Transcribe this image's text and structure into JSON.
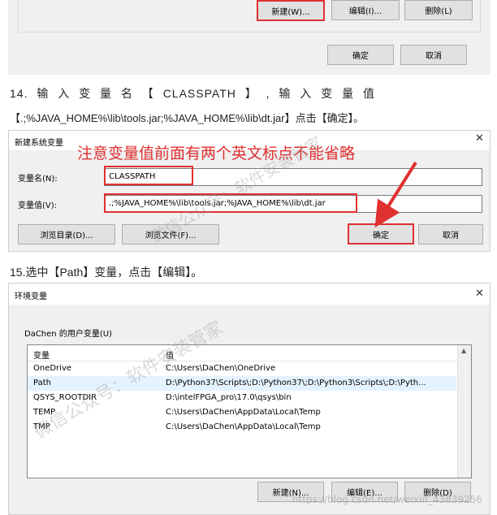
{
  "top_dialog": {
    "buttons": {
      "new": "新建(W)...",
      "edit": "编辑(I)...",
      "delete": "删除(L)"
    },
    "ok": "确定",
    "cancel": "取消"
  },
  "step14": {
    "line1": "14. 输 入 变 量 名 【 CLASSPATH 】 , 输 入 变 量 值",
    "line2": "【.;%JAVA_HOME%\\lib\\tools.jar;%JAVA_HOME%\\lib\\dt.jar】点击【确定】。"
  },
  "new_var_dialog": {
    "title": "新建系统变量",
    "annotation": "注意变量值前面有两个英文标点不能省略",
    "name_label": "变量名(N):",
    "name_value": "CLASSPATH",
    "value_label": "变量值(V):",
    "value_value": ".;%JAVA_HOME%\\lib\\tools.jar;%JAVA_HOME%\\lib\\dt.jar",
    "browse_dir": "浏览目录(D)...",
    "browse_file": "浏览文件(F)...",
    "ok": "确定",
    "cancel": "取消"
  },
  "step15": {
    "text": "15.选中【Path】变量，点击【编辑】。"
  },
  "env_dialog": {
    "title": "环境变量",
    "user_group": "DaChen 的用户变量(U)",
    "col_var": "变量",
    "col_val": "值",
    "rows": [
      {
        "name": "OneDrive",
        "value": "C:\\Users\\DaChen\\OneDrive"
      },
      {
        "name": "Path",
        "value": "D:\\Python37\\Scripts\\;D:\\Python37\\;D:\\Python3\\Scripts\\;D:\\Pyth..."
      },
      {
        "name": "QSYS_ROOTDIR",
        "value": "D:\\intelFPGA_pro\\17.0\\qsys\\bin"
      },
      {
        "name": "TEMP",
        "value": "C:\\Users\\DaChen\\AppData\\Local\\Temp"
      },
      {
        "name": "TMP",
        "value": "C:\\Users\\DaChen\\AppData\\Local\\Temp"
      }
    ],
    "buttons": {
      "new": "新建(N)...",
      "edit": "编辑(E)...",
      "delete": "删除(D)"
    }
  },
  "watermarks": {
    "wm1": "微信公众号：软件安装管家",
    "wm2": "微信公众号：软件安装管家",
    "wm3": "https://blog.csdn.net/weixin_43839256"
  },
  "colors": {
    "highlight": "#e03030",
    "dialog_bg": "#f0f0f0",
    "annotation": "#e03030"
  }
}
